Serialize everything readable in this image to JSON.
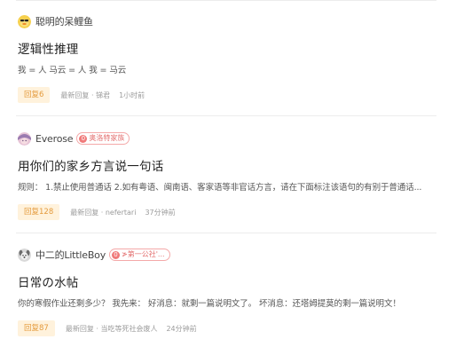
{
  "posts": [
    {
      "author": "聪明的呆鲤鱼",
      "avatar_icon": "duck-avatar-icon",
      "title": "逻辑性推理",
      "excerpt": "我 = 人 马云 = 人 我 = 马云",
      "reply_label": "回复6",
      "last_reply": "最新回复 · 锑君",
      "time": "1小时前"
    },
    {
      "author": "Everose",
      "avatar_icon": "anime-avatar-icon",
      "badge_num": "0",
      "badge_label": "奥洛特家族",
      "title": "用你们的家乡方言说一句话",
      "excerpt": "规则： 1.禁止使用普通话 2.如有粤语、闽南语、客家语等非官话方言，请在下面标注该语句的有别于普通话...",
      "reply_label": "回复128",
      "last_reply": "最新回复 · nefertari",
      "time": "37分钟前"
    },
    {
      "author": "中二的LittleBoy",
      "avatar_icon": "dog-avatar-icon",
      "badge_num": "0",
      "badge_label": "≯第一公社'...",
      "title": "日常の水帖",
      "excerpt": "你的寒假作业还剩多少？ 我先来： 好消息：就剩一篇说明文了。 坏消息：还塔姆提莫的剩一篇说明文！",
      "reply_label": "回复87",
      "last_reply": "最新回复 · 当吃等死社会废人",
      "time": "24分钟前"
    }
  ],
  "colors": {
    "reply_bg": "#fff2dc",
    "reply_text": "#e49a3c",
    "badge_border": "#f4a9a9",
    "badge_text": "#e36f6f",
    "divider": "#ececec"
  }
}
